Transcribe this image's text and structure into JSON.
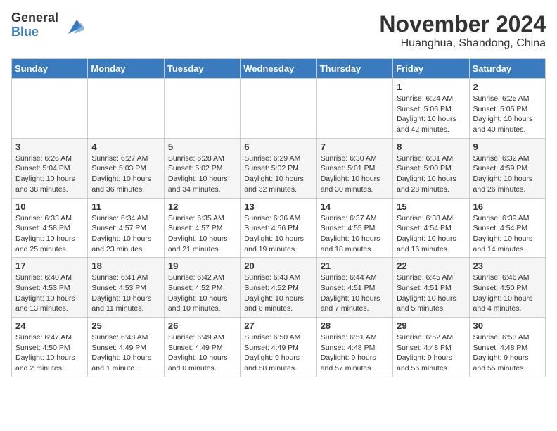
{
  "logo": {
    "general": "General",
    "blue": "Blue"
  },
  "header": {
    "month": "November 2024",
    "location": "Huanghua, Shandong, China"
  },
  "weekdays": [
    "Sunday",
    "Monday",
    "Tuesday",
    "Wednesday",
    "Thursday",
    "Friday",
    "Saturday"
  ],
  "weeks": [
    [
      {
        "day": "",
        "info": ""
      },
      {
        "day": "",
        "info": ""
      },
      {
        "day": "",
        "info": ""
      },
      {
        "day": "",
        "info": ""
      },
      {
        "day": "",
        "info": ""
      },
      {
        "day": "1",
        "info": "Sunrise: 6:24 AM\nSunset: 5:06 PM\nDaylight: 10 hours and 42 minutes."
      },
      {
        "day": "2",
        "info": "Sunrise: 6:25 AM\nSunset: 5:05 PM\nDaylight: 10 hours and 40 minutes."
      }
    ],
    [
      {
        "day": "3",
        "info": "Sunrise: 6:26 AM\nSunset: 5:04 PM\nDaylight: 10 hours and 38 minutes."
      },
      {
        "day": "4",
        "info": "Sunrise: 6:27 AM\nSunset: 5:03 PM\nDaylight: 10 hours and 36 minutes."
      },
      {
        "day": "5",
        "info": "Sunrise: 6:28 AM\nSunset: 5:02 PM\nDaylight: 10 hours and 34 minutes."
      },
      {
        "day": "6",
        "info": "Sunrise: 6:29 AM\nSunset: 5:02 PM\nDaylight: 10 hours and 32 minutes."
      },
      {
        "day": "7",
        "info": "Sunrise: 6:30 AM\nSunset: 5:01 PM\nDaylight: 10 hours and 30 minutes."
      },
      {
        "day": "8",
        "info": "Sunrise: 6:31 AM\nSunset: 5:00 PM\nDaylight: 10 hours and 28 minutes."
      },
      {
        "day": "9",
        "info": "Sunrise: 6:32 AM\nSunset: 4:59 PM\nDaylight: 10 hours and 26 minutes."
      }
    ],
    [
      {
        "day": "10",
        "info": "Sunrise: 6:33 AM\nSunset: 4:58 PM\nDaylight: 10 hours and 25 minutes."
      },
      {
        "day": "11",
        "info": "Sunrise: 6:34 AM\nSunset: 4:57 PM\nDaylight: 10 hours and 23 minutes."
      },
      {
        "day": "12",
        "info": "Sunrise: 6:35 AM\nSunset: 4:57 PM\nDaylight: 10 hours and 21 minutes."
      },
      {
        "day": "13",
        "info": "Sunrise: 6:36 AM\nSunset: 4:56 PM\nDaylight: 10 hours and 19 minutes."
      },
      {
        "day": "14",
        "info": "Sunrise: 6:37 AM\nSunset: 4:55 PM\nDaylight: 10 hours and 18 minutes."
      },
      {
        "day": "15",
        "info": "Sunrise: 6:38 AM\nSunset: 4:54 PM\nDaylight: 10 hours and 16 minutes."
      },
      {
        "day": "16",
        "info": "Sunrise: 6:39 AM\nSunset: 4:54 PM\nDaylight: 10 hours and 14 minutes."
      }
    ],
    [
      {
        "day": "17",
        "info": "Sunrise: 6:40 AM\nSunset: 4:53 PM\nDaylight: 10 hours and 13 minutes."
      },
      {
        "day": "18",
        "info": "Sunrise: 6:41 AM\nSunset: 4:53 PM\nDaylight: 10 hours and 11 minutes."
      },
      {
        "day": "19",
        "info": "Sunrise: 6:42 AM\nSunset: 4:52 PM\nDaylight: 10 hours and 10 minutes."
      },
      {
        "day": "20",
        "info": "Sunrise: 6:43 AM\nSunset: 4:52 PM\nDaylight: 10 hours and 8 minutes."
      },
      {
        "day": "21",
        "info": "Sunrise: 6:44 AM\nSunset: 4:51 PM\nDaylight: 10 hours and 7 minutes."
      },
      {
        "day": "22",
        "info": "Sunrise: 6:45 AM\nSunset: 4:51 PM\nDaylight: 10 hours and 5 minutes."
      },
      {
        "day": "23",
        "info": "Sunrise: 6:46 AM\nSunset: 4:50 PM\nDaylight: 10 hours and 4 minutes."
      }
    ],
    [
      {
        "day": "24",
        "info": "Sunrise: 6:47 AM\nSunset: 4:50 PM\nDaylight: 10 hours and 2 minutes."
      },
      {
        "day": "25",
        "info": "Sunrise: 6:48 AM\nSunset: 4:49 PM\nDaylight: 10 hours and 1 minute."
      },
      {
        "day": "26",
        "info": "Sunrise: 6:49 AM\nSunset: 4:49 PM\nDaylight: 10 hours and 0 minutes."
      },
      {
        "day": "27",
        "info": "Sunrise: 6:50 AM\nSunset: 4:49 PM\nDaylight: 9 hours and 58 minutes."
      },
      {
        "day": "28",
        "info": "Sunrise: 6:51 AM\nSunset: 4:48 PM\nDaylight: 9 hours and 57 minutes."
      },
      {
        "day": "29",
        "info": "Sunrise: 6:52 AM\nSunset: 4:48 PM\nDaylight: 9 hours and 56 minutes."
      },
      {
        "day": "30",
        "info": "Sunrise: 6:53 AM\nSunset: 4:48 PM\nDaylight: 9 hours and 55 minutes."
      }
    ]
  ]
}
